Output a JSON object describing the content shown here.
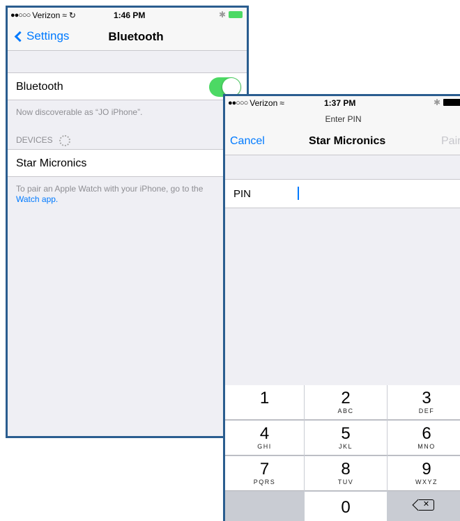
{
  "screen1": {
    "status": {
      "carrier": "Verizon",
      "time": "1:46 PM"
    },
    "nav": {
      "back_label": "Settings",
      "title": "Bluetooth"
    },
    "bluetooth_row": {
      "label": "Bluetooth",
      "toggle_on": true
    },
    "discoverable_text": "Now discoverable as “JO iPhone”.",
    "devices_header": "DEVICES",
    "devices": [
      {
        "name": "Star Micronics"
      }
    ],
    "footer_text": "To pair an Apple Watch with your iPhone, go to the",
    "footer_link": "Watch app."
  },
  "screen2": {
    "status": {
      "carrier": "Verizon",
      "time": "1:37 PM"
    },
    "prompt": "Enter PIN",
    "nav": {
      "cancel_label": "Cancel",
      "title": "Star Micronics",
      "pair_label": "Pair"
    },
    "pin_field": {
      "label": "PIN",
      "value": "",
      "placeholder": ""
    },
    "keypad": [
      {
        "num": "1",
        "letters": ""
      },
      {
        "num": "2",
        "letters": "ABC"
      },
      {
        "num": "3",
        "letters": "DEF"
      },
      {
        "num": "4",
        "letters": "GHI"
      },
      {
        "num": "5",
        "letters": "JKL"
      },
      {
        "num": "6",
        "letters": "MNO"
      },
      {
        "num": "7",
        "letters": "PQRS"
      },
      {
        "num": "8",
        "letters": "TUV"
      },
      {
        "num": "9",
        "letters": "WXYZ"
      },
      {
        "num": "0",
        "letters": ""
      }
    ]
  },
  "colors": {
    "accent": "#007aff",
    "toggle_on": "#4cd964",
    "frame": "#2a5d8f",
    "background": "#efeff4"
  }
}
